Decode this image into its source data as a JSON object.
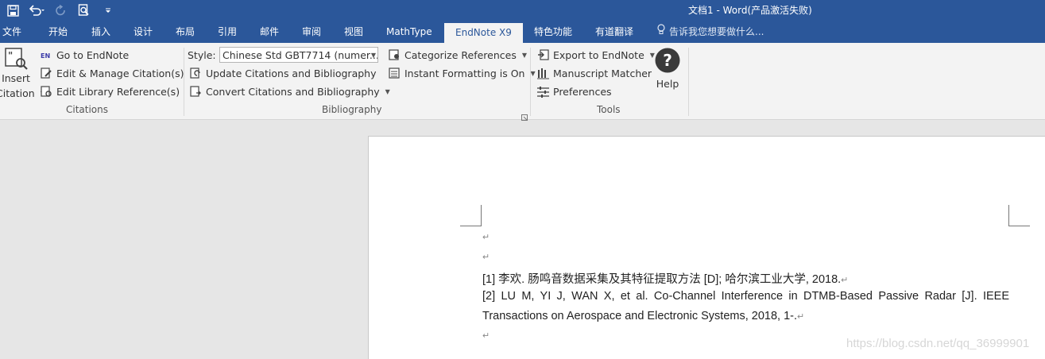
{
  "window": {
    "title": "文档1 - Word(产品激活失败)"
  },
  "tabs": [
    "文件",
    "开始",
    "插入",
    "设计",
    "布局",
    "引用",
    "邮件",
    "审阅",
    "视图",
    "MathType",
    "EndNote X9",
    "特色功能",
    "有道翻译"
  ],
  "tell_me": "告诉我您想要做什么...",
  "ribbon": {
    "citations": {
      "insert_label_1": "Insert",
      "insert_label_2": "Citation",
      "go_to_endnote": "Go to EndNote",
      "edit_manage": "Edit & Manage Citation(s)",
      "edit_library": "Edit Library Reference(s)",
      "group_label": "Citations"
    },
    "bibliography": {
      "style_label": "Style:",
      "style_value": "Chinese Std GBT7714 (numer...",
      "update": "Update Citations and Bibliography",
      "convert": "Convert Citations and Bibliography",
      "categorize": "Categorize References",
      "instant_formatting": "Instant Formatting is On",
      "group_label": "Bibliography"
    },
    "tools": {
      "export": "Export to EndNote",
      "manuscript": "Manuscript Matcher",
      "preferences": "Preferences",
      "help": "Help",
      "group_label": "Tools"
    }
  },
  "document": {
    "paragraph_mark": "↵",
    "ref1": "[1]    李欢. 肠鸣音数据采集及其特征提取方法  [D]; 哈尔滨工业大学, 2018.",
    "ref2_line1": "[2]    LU M, YI J, WAN X, et al. Co-Channel Interference in DTMB-Based Passive Radar [J]. IEEE",
    "ref2_line2": "Transactions on Aerospace and Electronic Systems, 2018, 1-."
  },
  "watermark": "https://blog.csdn.net/qq_36999901"
}
